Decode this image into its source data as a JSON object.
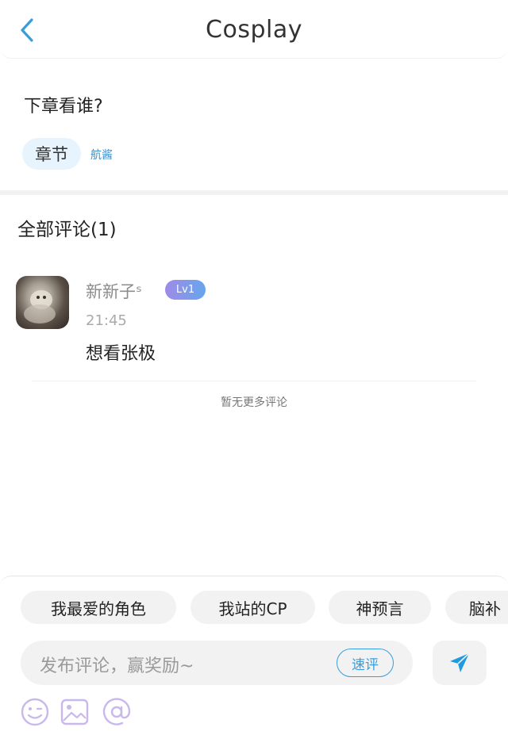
{
  "header": {
    "title": "Cosplay",
    "back_icon": "chevron-left-icon",
    "accent": "#3a9ddb"
  },
  "post": {
    "question": "下章看谁?",
    "tag": "章节",
    "author": "航酱"
  },
  "comments": {
    "title": "全部评论(1)",
    "items": [
      {
        "username": "新新子ˢ",
        "level": "Lv1",
        "time": "21:45",
        "text": "想看张极"
      }
    ],
    "no_more": "暂无更多评论"
  },
  "quick_chips": [
    "我最爱的角色",
    "我站的CP",
    "神预言",
    "脑补"
  ],
  "composer": {
    "placeholder": "发布评论，赢奖励~",
    "quick_review": "速评",
    "send_icon": "send-icon",
    "tools": [
      "emoji-icon",
      "image-icon",
      "at-icon"
    ],
    "tool_color": "#c9b8ee"
  }
}
